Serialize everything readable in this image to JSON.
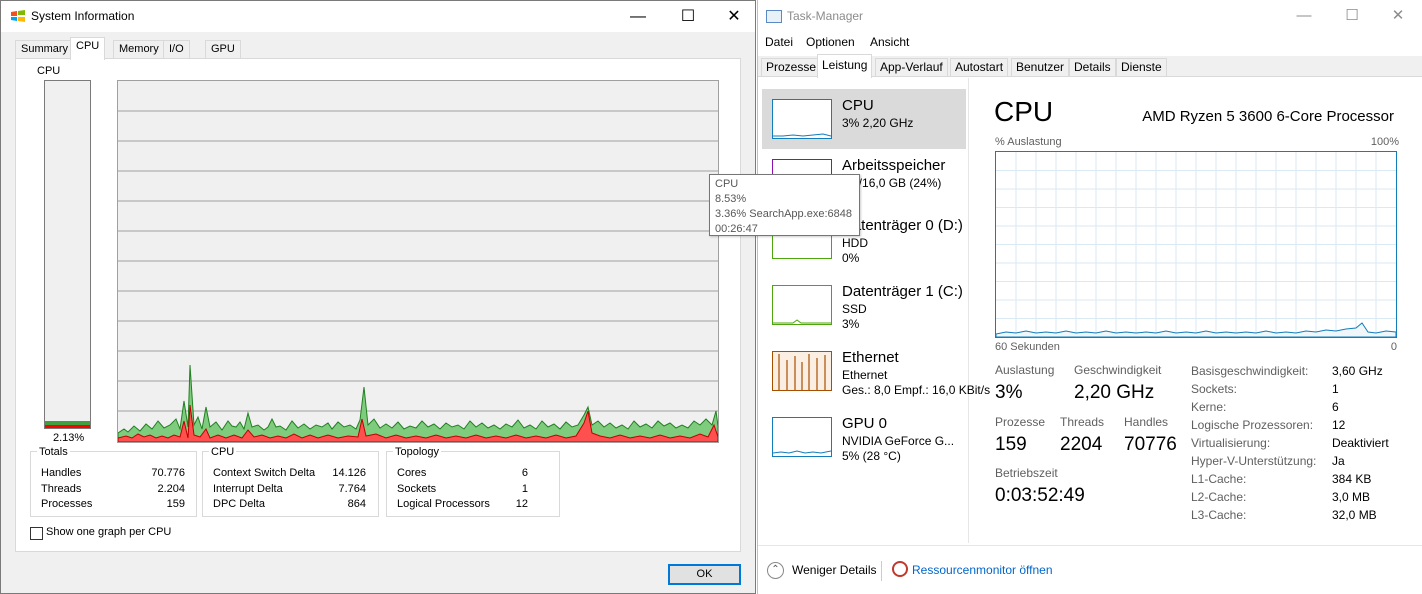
{
  "sysinfo": {
    "title": "System Information",
    "tabs": [
      "Summary",
      "CPU",
      "Memory",
      "I/O",
      "GPU"
    ],
    "active_tab": "CPU",
    "cpu_label": "CPU",
    "cpu_percent": "2.13%",
    "cpu_usage_fraction": 0.0213,
    "totals": {
      "title": "Totals",
      "rows": [
        {
          "k": "Handles",
          "v": "70.776"
        },
        {
          "k": "Threads",
          "v": "2.204"
        },
        {
          "k": "Processes",
          "v": "159"
        }
      ]
    },
    "cpu_group": {
      "title": "CPU",
      "rows": [
        {
          "k": "Context Switch Delta",
          "v": "14.126"
        },
        {
          "k": "Interrupt Delta",
          "v": "7.764"
        },
        {
          "k": "DPC Delta",
          "v": "864"
        }
      ]
    },
    "topology": {
      "title": "Topology",
      "rows": [
        {
          "k": "Cores",
          "v": "6"
        },
        {
          "k": "Sockets",
          "v": "1"
        },
        {
          "k": "Logical Processors",
          "v": "12"
        }
      ]
    },
    "checkbox_label": "Show one graph per CPU",
    "ok_label": "OK",
    "tooltip": [
      "CPU",
      "8.53%",
      "3.36% SearchApp.exe:6848",
      "00:26:47"
    ]
  },
  "taskmgr": {
    "title": "Task-Manager",
    "menu": [
      "Datei",
      "Optionen",
      "Ansicht"
    ],
    "tabs": [
      "Prozesse",
      "Leistung",
      "App-Verlauf",
      "Autostart",
      "Benutzer",
      "Details",
      "Dienste"
    ],
    "active_tab": "Leistung",
    "resources": [
      {
        "name": "CPU",
        "sub1": "3% 2,20 GHz",
        "sub2": "",
        "color": "#117dbb"
      },
      {
        "name": "Arbeitsspeicher",
        "sub1": "3,9/16,0 GB (24%)",
        "sub2": "",
        "color": "#8b12ae"
      },
      {
        "name": "Datenträger 0 (D:)",
        "sub1": "HDD",
        "sub2": "0%",
        "color": "#4da60c"
      },
      {
        "name": "Datenträger 1 (C:)",
        "sub1": "SSD",
        "sub2": "3%",
        "color": "#4da60c"
      },
      {
        "name": "Ethernet",
        "sub1": "Ethernet",
        "sub2": "Ges.: 8,0  Empf.: 16,0 KBit/s",
        "color": "#a74f01"
      },
      {
        "name": "GPU 0",
        "sub1": "NVIDIA GeForce G...",
        "sub2": "5% (28 °C)",
        "color": "#117dbb"
      }
    ],
    "main": {
      "heading": "CPU",
      "model": "AMD Ryzen 5 3600 6-Core Processor",
      "util_label": "% Auslastung",
      "util_max": "100%",
      "time_left": "60 Sekunden",
      "time_right": "0",
      "stats": {
        "auslastung_label": "Auslastung",
        "auslastung_value": "3%",
        "geschwindigkeit_label": "Geschwindigkeit",
        "geschwindigkeit_value": "2,20 GHz",
        "prozesse_label": "Prozesse",
        "prozesse_value": "159",
        "threads_label": "Threads",
        "threads_value": "2204",
        "handles_label": "Handles",
        "handles_value": "70776",
        "betriebszeit_label": "Betriebszeit",
        "betriebszeit_value": "0:03:52:49"
      },
      "specs": [
        {
          "k": "Basisgeschwindigkeit:",
          "v": "3,60 GHz"
        },
        {
          "k": "Sockets:",
          "v": "1"
        },
        {
          "k": "Kerne:",
          "v": "6"
        },
        {
          "k": "Logische Prozessoren:",
          "v": "12"
        },
        {
          "k": "Virtualisierung:",
          "v": "Deaktiviert"
        },
        {
          "k": "Hyper-V-Unterstützung:",
          "v": "Ja"
        },
        {
          "k": "L1-Cache:",
          "v": "384 KB"
        },
        {
          "k": "L2-Cache:",
          "v": "3,0 MB"
        },
        {
          "k": "L3-Cache:",
          "v": "32,0 MB"
        }
      ]
    },
    "footer": {
      "fewer_details": "Weniger Details",
      "resmon": "Ressourcenmonitor öffnen"
    }
  }
}
